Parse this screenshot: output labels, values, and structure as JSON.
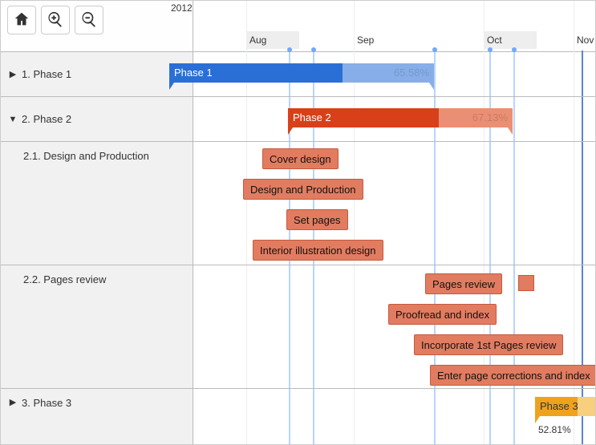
{
  "year": "2012",
  "months": {
    "aug": "Aug",
    "sep": "Sep",
    "oct": "Oct",
    "nov": "Nov"
  },
  "toolbar": {
    "home": "Home",
    "zoomIn": "Zoom In",
    "zoomOut": "Zoom Out"
  },
  "tree": {
    "phase1": "1. Phase 1",
    "phase2": "2. Phase 2",
    "design": "2.1. Design and Production",
    "pages": "2.2. Pages review",
    "phase3": "3. Phase 3"
  },
  "bars": {
    "phase1": {
      "label": "Phase 1",
      "pct": "65.58%"
    },
    "phase2": {
      "label": "Phase 2",
      "pct": "67.13%"
    },
    "phase3": {
      "label": "Phase 3",
      "pct": "52.81%"
    }
  },
  "tasks": {
    "cover": "Cover design",
    "designProd": "Design and Production",
    "setPages": "Set pages",
    "interior": "Interior illustration design",
    "pagesReview": "Pages review",
    "proofread": "Proofread and index",
    "incorporate": "Incorporate 1st Pages review",
    "corrections": "Enter page corrections and index"
  },
  "chart_data": {
    "type": "gantt",
    "title": "",
    "x_axis": {
      "unit": "month",
      "range": [
        "2012-07",
        "2012-11"
      ],
      "ticks": [
        "Aug",
        "Sep",
        "Oct",
        "Nov"
      ]
    },
    "rows": [
      {
        "id": "1",
        "label": "1. Phase 1",
        "type": "summary",
        "bar": {
          "start": "2012-07-09",
          "end": "2012-09-06",
          "progress_pct": 65.58,
          "color": "blue",
          "label": "Phase 1"
        }
      },
      {
        "id": "2",
        "label": "2. Phase 2",
        "type": "summary",
        "expanded": true,
        "bar": {
          "start": "2012-08-07",
          "end": "2012-10-11",
          "progress_pct": 67.13,
          "color": "red",
          "label": "Phase 2"
        }
      },
      {
        "id": "2.1",
        "parent": "2",
        "label": "2.1. Design and Production",
        "type": "group",
        "tasks": [
          {
            "label": "Cover design",
            "start": "2012-07-30",
            "end": "2012-08-23"
          },
          {
            "label": "Design and Production",
            "start": "2012-07-23",
            "end": "2012-08-30"
          },
          {
            "label": "Set pages",
            "start": "2012-08-07",
            "end": "2012-08-24"
          },
          {
            "label": "Interior illustration design",
            "start": "2012-07-25",
            "end": "2012-09-04"
          }
        ]
      },
      {
        "id": "2.2",
        "parent": "2",
        "label": "2.2. Pages review",
        "type": "group",
        "tasks": [
          {
            "label": "Pages review",
            "start": "2012-09-07",
            "end": "2012-09-29"
          },
          {
            "label": "Proofread and index",
            "start": "2012-09-02",
            "end": "2012-10-04"
          },
          {
            "label": "Incorporate 1st Pages review",
            "start": "2012-09-10",
            "end": "2012-10-24"
          },
          {
            "label": "Enter page corrections and index",
            "start": "2012-09-14",
            "end": "2012-11-05"
          }
        ],
        "milestones": [
          {
            "date": "2012-10-09"
          }
        ]
      },
      {
        "id": "3",
        "label": "3. Phase 3",
        "type": "summary",
        "bar": {
          "start": "2012-10-13",
          "end": "2012-11-05",
          "progress_pct": 52.81,
          "color": "orange",
          "label": "Phase 3"
        }
      }
    ]
  }
}
